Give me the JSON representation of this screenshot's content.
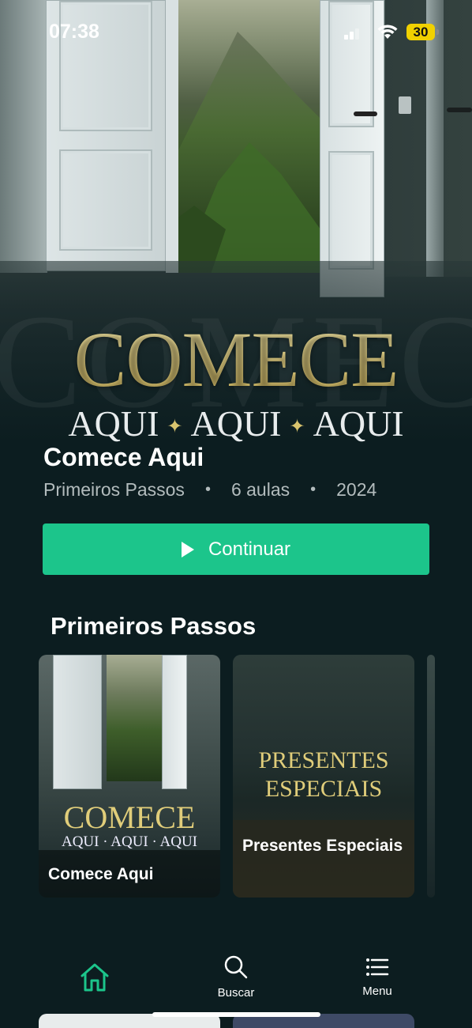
{
  "status_bar": {
    "time": "07:38",
    "battery": "30"
  },
  "hero": {
    "title": "COMECE",
    "subtitle_words": [
      "AQUI",
      "AQUI",
      "AQUI"
    ],
    "separator": "✦"
  },
  "course": {
    "title": "Comece Aqui",
    "category": "Primeiros Passos",
    "lessons": "6 aulas",
    "year": "2024",
    "bullet": "•"
  },
  "continue_button": {
    "label": "Continuar"
  },
  "section": {
    "title": "Primeiros Passos",
    "cards": [
      {
        "label": "Comece Aqui",
        "art_title": "COMECE",
        "art_sub": "AQUI · AQUI · AQUI"
      },
      {
        "label": "Presentes Especiais",
        "art_title_1": "PRESENTES",
        "art_title_2": "ESPECIAIS"
      }
    ]
  },
  "tabbar": {
    "home_icon": "home-icon",
    "search_label": "Buscar",
    "menu_label": "Menu",
    "active_color": "#1cc58b"
  },
  "colors": {
    "accent": "#1cc58b",
    "background": "#0c1d20",
    "gold": "#e0cd7a"
  }
}
